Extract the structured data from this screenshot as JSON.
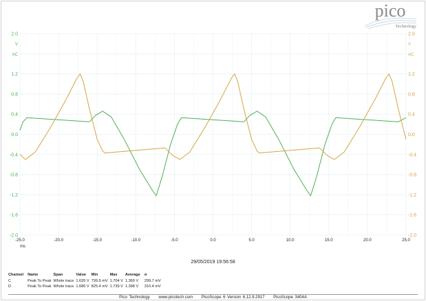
{
  "logo": {
    "text": "pico",
    "subtext": "Technology"
  },
  "chart_data": {
    "type": "line",
    "xlabel": "ms",
    "xlim": [
      -25,
      25
    ],
    "ylim": [
      -2.0,
      2.0
    ],
    "x_ticks": [
      "-25.0",
      "-20.0",
      "-15.0",
      "-10.0",
      "-5.0",
      "0.0",
      "5.0",
      "10.0",
      "15.0",
      "20.0",
      "25.0"
    ],
    "y_ticks": [
      "2.0",
      "1.2",
      "0.8",
      "0.4",
      "0.0",
      "-0.4",
      "-0.8",
      "-1.2",
      "-1.6",
      "-2.0"
    ],
    "y_ticks_right": [
      "2.0",
      "1.2",
      "0.8",
      "0.4",
      "0.0",
      "-0.4",
      "-0.8",
      "-1.2",
      "-1.6",
      "-2.0"
    ],
    "y_unit_left": "V",
    "y_coupling_left": "AC",
    "y_unit_right": "V",
    "y_coupling_right": "AC",
    "grid": true,
    "series": [
      {
        "color": "#4caf50",
        "points": [
          [
            -25,
            0.08
          ],
          [
            -24.6,
            0.25
          ],
          [
            -24.1,
            0.33
          ],
          [
            -16.0,
            0.25
          ],
          [
            -15.2,
            0.38
          ],
          [
            -14.3,
            0.46
          ],
          [
            -13.2,
            0.35
          ],
          [
            -11.5,
            -0.1
          ],
          [
            -9.5,
            -0.7
          ],
          [
            -7.9,
            -1.1
          ],
          [
            -7.35,
            -1.22
          ],
          [
            -6.6,
            -0.85
          ],
          [
            -5.5,
            -0.2
          ],
          [
            -4.6,
            0.2
          ],
          [
            -4.1,
            0.33
          ],
          [
            4.0,
            0.25
          ],
          [
            4.8,
            0.38
          ],
          [
            5.7,
            0.46
          ],
          [
            6.8,
            0.35
          ],
          [
            8.5,
            -0.1
          ],
          [
            10.5,
            -0.7
          ],
          [
            12.1,
            -1.1
          ],
          [
            12.65,
            -1.22
          ],
          [
            13.4,
            -0.85
          ],
          [
            14.5,
            -0.2
          ],
          [
            15.4,
            0.2
          ],
          [
            15.9,
            0.33
          ],
          [
            24.0,
            0.25
          ],
          [
            25,
            0.33
          ]
        ]
      },
      {
        "color": "#d4a440",
        "points": [
          [
            -25,
            -0.4
          ],
          [
            -24.3,
            -0.5
          ],
          [
            -23,
            -0.35
          ],
          [
            -21,
            0.15
          ],
          [
            -19,
            0.7
          ],
          [
            -17.6,
            1.12
          ],
          [
            -17.2,
            1.2
          ],
          [
            -16.8,
            1.05
          ],
          [
            -16,
            0.5
          ],
          [
            -15,
            -0.1
          ],
          [
            -14.3,
            -0.33
          ],
          [
            -14,
            -0.37
          ],
          [
            -6.2,
            -0.27
          ],
          [
            -5.2,
            -0.42
          ],
          [
            -4.3,
            -0.5
          ],
          [
            -3,
            -0.35
          ],
          [
            -1,
            0.15
          ],
          [
            1,
            0.7
          ],
          [
            2.4,
            1.12
          ],
          [
            2.8,
            1.2
          ],
          [
            3.2,
            1.05
          ],
          [
            4,
            0.5
          ],
          [
            5,
            -0.1
          ],
          [
            5.7,
            -0.33
          ],
          [
            6,
            -0.37
          ],
          [
            13.8,
            -0.27
          ],
          [
            14.8,
            -0.42
          ],
          [
            15.7,
            -0.5
          ],
          [
            17,
            -0.35
          ],
          [
            19,
            0.15
          ],
          [
            21,
            0.7
          ],
          [
            22.4,
            1.12
          ],
          [
            22.8,
            1.2
          ],
          [
            23.2,
            1.05
          ],
          [
            24,
            0.5
          ],
          [
            25,
            -0.1
          ]
        ]
      }
    ]
  },
  "timestamp": "29/05/2019 19:56:58",
  "measurements": {
    "headers": [
      "Channel",
      "Name",
      "Span",
      "Value",
      "Min",
      "Max",
      "Average",
      "σ"
    ],
    "rows": [
      [
        "C",
        "Peak To Peak",
        "Whole trace",
        "1.635 V",
        "799.9 mV",
        "1.704 V",
        "1.369 V",
        "299.7 mV"
      ],
      [
        "D",
        "Peak To Peak",
        "Whole trace",
        "1.686 V",
        "825.4 mV",
        "1.739 V",
        "1.398 V",
        "310.4 mV"
      ]
    ]
  },
  "footer": [
    "Pico Technology",
    "www.picotech.com",
    "PicoScope 6 Version 6.12.9.2917",
    "PicoScope 3404A"
  ]
}
